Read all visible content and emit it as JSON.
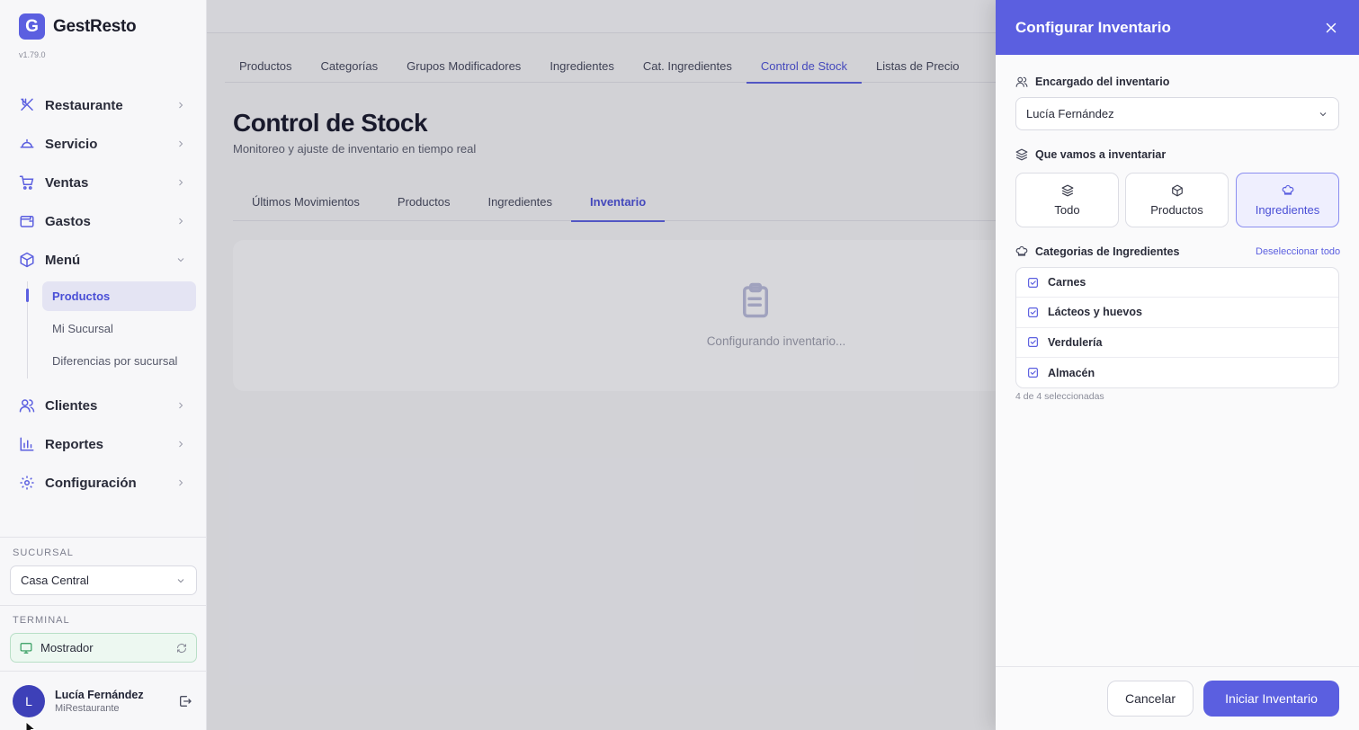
{
  "app": {
    "logo_letter": "G",
    "name": "GestResto",
    "version": "v1.79.0",
    "accent": "#5b5fe0"
  },
  "sidebar": {
    "items": [
      {
        "label": "Restaurante",
        "icon": "utensils-icon"
      },
      {
        "label": "Servicio",
        "icon": "cloche-icon"
      },
      {
        "label": "Ventas",
        "icon": "cart-icon"
      },
      {
        "label": "Gastos",
        "icon": "wallet-icon"
      },
      {
        "label": "Menú",
        "icon": "box-icon",
        "expanded": true
      },
      {
        "label": "Clientes",
        "icon": "users-icon"
      },
      {
        "label": "Reportes",
        "icon": "bar-chart-icon"
      },
      {
        "label": "Configuración",
        "icon": "gear-icon"
      }
    ],
    "menu_subitems": [
      {
        "label": "Productos",
        "active": true
      },
      {
        "label": "Mi Sucursal",
        "active": false
      },
      {
        "label": "Diferencias por sucursal",
        "active": false
      }
    ],
    "branch": {
      "caption": "SUCURSAL",
      "value": "Casa Central"
    },
    "terminal": {
      "caption": "TERMINAL",
      "value": "Mostrador"
    },
    "user": {
      "initial": "L",
      "name": "Lucía Fernández",
      "org": "MiRestaurante"
    }
  },
  "main": {
    "top_tabs": [
      "Productos",
      "Categorías",
      "Grupos Modificadores",
      "Ingredientes",
      "Cat. Ingredientes",
      "Control de Stock",
      "Listas de Precio"
    ],
    "top_tab_active": "Control de Stock",
    "title": "Control de Stock",
    "subtitle": "Monitoreo y ajuste de inventario en tiempo real",
    "inner_tabs": [
      "Últimos Movimientos",
      "Productos",
      "Ingredientes",
      "Inventario"
    ],
    "inner_tab_active": "Inventario",
    "loading_text": "Configurando inventario..."
  },
  "drawer": {
    "title": "Configurar Inventario",
    "manager_label": "Encargado del inventario",
    "manager_value": "Lucía Fernández",
    "scope_label": "Que vamos a inventariar",
    "scope_options": [
      {
        "label": "Todo",
        "icon": "layers-icon",
        "active": false
      },
      {
        "label": "Productos",
        "icon": "box-icon",
        "active": false
      },
      {
        "label": "Ingredientes",
        "icon": "chef-hat-icon",
        "active": true
      }
    ],
    "categories_label": "Categorias de Ingredientes",
    "deselect_label": "Deseleccionar todo",
    "categories": [
      {
        "label": "Carnes",
        "checked": true
      },
      {
        "label": "Lácteos y huevos",
        "checked": true
      },
      {
        "label": "Verdulería",
        "checked": true
      },
      {
        "label": "Almacén",
        "checked": true
      }
    ],
    "selected_count": "4 de 4 seleccionadas",
    "cancel_label": "Cancelar",
    "start_label": "Iniciar Inventario"
  }
}
